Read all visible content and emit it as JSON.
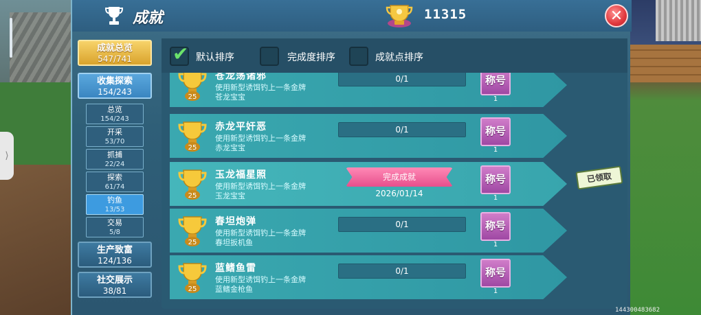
{
  "header": {
    "title": "成就",
    "score": "11315",
    "close_label": "✕"
  },
  "nav": {
    "overview": {
      "label": "成就总览",
      "count": "547/741"
    },
    "collect": {
      "label": "收集探索",
      "count": "154/243"
    },
    "subs": [
      {
        "label": "总览",
        "count": "154/243"
      },
      {
        "label": "开采",
        "count": "53/70"
      },
      {
        "label": "抓捕",
        "count": "22/24"
      },
      {
        "label": "探索",
        "count": "61/74"
      },
      {
        "label": "钓鱼",
        "count": "13/53"
      },
      {
        "label": "交易",
        "count": "5/8"
      }
    ],
    "produce": {
      "label": "生产致富",
      "count": "124/136"
    },
    "social": {
      "label": "社交展示",
      "count": "38/81"
    }
  },
  "sort": {
    "default": "默认排序",
    "completion": "完成度排序",
    "points": "成就点排序",
    "selected": "default"
  },
  "rows": [
    {
      "title": "苍龙荡诸邪",
      "desc1": "使用新型诱饵钓上一条金牌",
      "desc2": "苍龙宝宝",
      "level": "25",
      "progress": "0/1",
      "reward": "称号",
      "reward_count": "1"
    },
    {
      "title": "赤龙平奸恶",
      "desc1": "使用新型诱饵钓上一条金牌",
      "desc2": "赤龙宝宝",
      "level": "25",
      "progress": "0/1",
      "reward": "称号",
      "reward_count": "1"
    },
    {
      "title": "玉龙福星照",
      "desc1": "使用新型诱饵钓上一条金牌",
      "desc2": "玉龙宝宝",
      "level": "25",
      "complete": "完成成就",
      "date": "2026/01/14",
      "reward": "称号",
      "reward_count": "1",
      "claim": "已领取"
    },
    {
      "title": "春坦炮弹",
      "desc1": "使用新型诱饵钓上一条金牌",
      "desc2": "春坦扳机鱼",
      "level": "25",
      "progress": "0/1",
      "reward": "称号",
      "reward_count": "1"
    },
    {
      "title": "蓝鳍鱼雷",
      "desc1": "使用新型诱饵钓上一条金牌",
      "desc2": "蓝鳍金枪鱼",
      "level": "25",
      "progress": "0/1",
      "reward": "称号",
      "reward_count": "1"
    }
  ],
  "footer_id": "144300483682",
  "colors": {
    "panel": "#2f5f78",
    "row": "#3aa8b0",
    "gold": "#d9a32c",
    "reward": "#b057b3",
    "complete": "#e74f8c"
  }
}
